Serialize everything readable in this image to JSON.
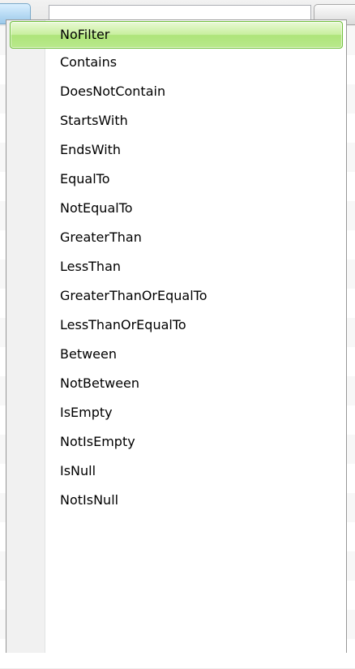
{
  "filter_row": {
    "input_value": ""
  },
  "dropdown": {
    "selected": "NoFilter",
    "options": [
      "NoFilter",
      "Contains",
      "DoesNotContain",
      "StartsWith",
      "EndsWith",
      "EqualTo",
      "NotEqualTo",
      "GreaterThan",
      "LessThan",
      "GreaterThanOrEqualTo",
      "LessThanOrEqualTo",
      "Between",
      "NotBetween",
      "IsEmpty",
      "NotIsEmpty",
      "IsNull",
      "NotIsNull"
    ]
  },
  "colors": {
    "selected_border": "#6fbf3a",
    "selected_fill": "#c9ef9f",
    "gutter": "#f1f1f1",
    "popup_border": "#979797"
  }
}
